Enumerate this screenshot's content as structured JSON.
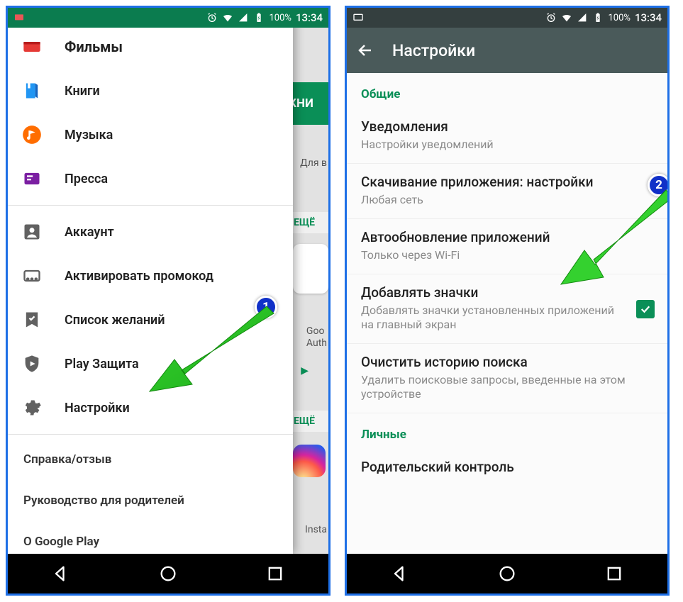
{
  "status": {
    "battery": "100%",
    "time": "13:34"
  },
  "phone1": {
    "menu": {
      "films": "Фильмы",
      "books": "Книги",
      "music": "Музыка",
      "press": "Пресса",
      "account": "Аккаунт",
      "promo": "Активировать промокод",
      "wishlist": "Список желаний",
      "protect": "Play Защита",
      "settings": "Настройки"
    },
    "footer": {
      "help": "Справка/отзыв",
      "parent_guide": "Руководство для родителей",
      "about": "О Google Play"
    },
    "bg": {
      "tab_books": "КНИ",
      "for_you": "Для в",
      "more1": "ЕЩЁ",
      "more2": "ЕЩЁ",
      "goog": "Goo",
      "auth": "Auth",
      "insta": "Insta"
    }
  },
  "phone2": {
    "title": "Настройки",
    "section_general": "Общие",
    "section_personal": "Личные",
    "items": {
      "notif": {
        "t": "Уведомления",
        "s": "Настройки уведомлений"
      },
      "download": {
        "t": "Скачивание приложения: настройки",
        "s": "Любая сеть"
      },
      "autoupdate": {
        "t": "Автообновление приложений",
        "s": "Только через Wi-Fi"
      },
      "icons": {
        "t": "Добавлять значки",
        "s": "Добавлять значки установленных приложений на главный экран"
      },
      "clearhist": {
        "t": "Очистить историю поиска",
        "s": "Удалить поисковые запросы, введенные на этом устройстве"
      },
      "parental": {
        "t": "Родительский контроль"
      }
    }
  },
  "annot": {
    "one": "1",
    "two": "2"
  }
}
